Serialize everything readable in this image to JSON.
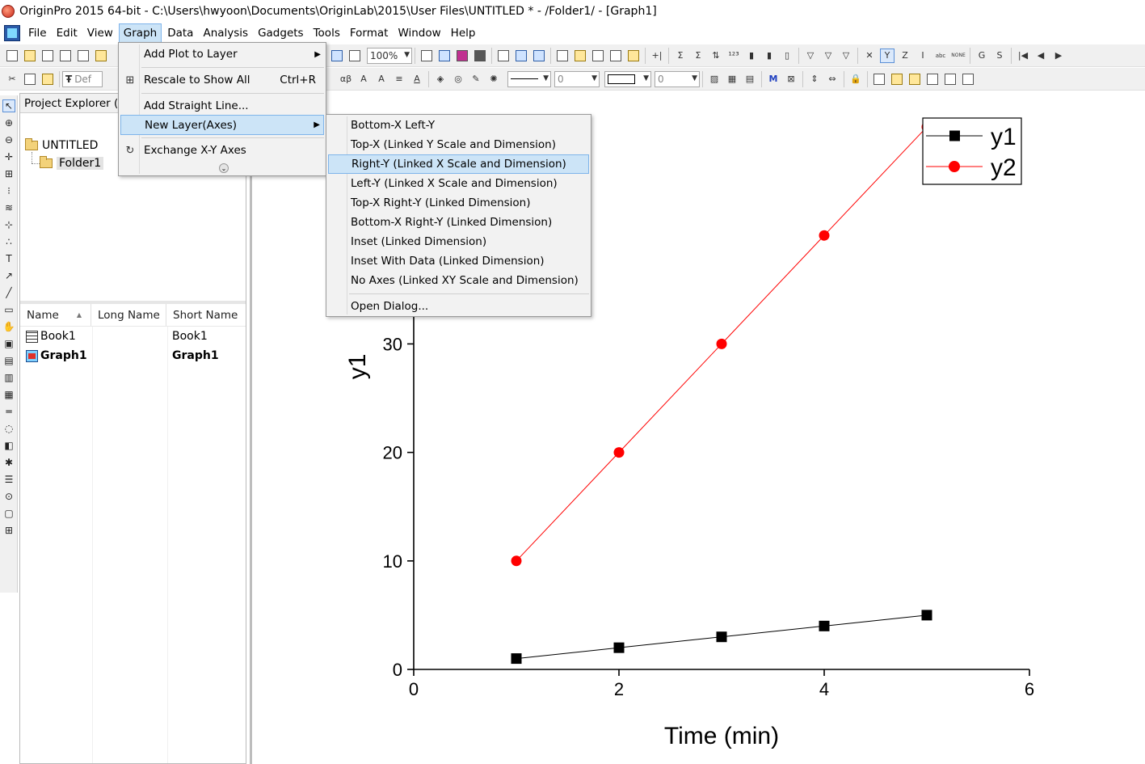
{
  "window": {
    "title": "OriginPro 2015 64-bit - C:\\Users\\hwyoon\\Documents\\OriginLab\\2015\\User Files\\UNTITLED * - /Folder1/ - [Graph1]"
  },
  "menubar": {
    "items": [
      "File",
      "Edit",
      "View",
      "Graph",
      "Data",
      "Analysis",
      "Gadgets",
      "Tools",
      "Format",
      "Window",
      "Help"
    ],
    "active": "Graph"
  },
  "toolbar": {
    "zoom": "100%",
    "font_combo": "Def",
    "line_width_value": "0",
    "border_value": "0"
  },
  "graph_menu": {
    "items": [
      {
        "label": "Add Plot to Layer",
        "has_submenu": true
      },
      {
        "label": "Rescale to Show All",
        "shortcut": "Ctrl+R"
      },
      {
        "label": "Add Straight Line..."
      },
      {
        "label": "New Layer(Axes)",
        "has_submenu": true,
        "highlighted": true
      },
      {
        "label": "Exchange X-Y Axes"
      }
    ]
  },
  "new_layer_submenu": {
    "items": [
      "Bottom-X Left-Y",
      "Top-X (Linked Y Scale and Dimension)",
      "Right-Y (Linked X Scale and Dimension)",
      "Left-Y (Linked X Scale and Dimension)",
      "Top-X Right-Y (Linked Dimension)",
      "Bottom-X Right-Y (Linked Dimension)",
      "Inset (Linked Dimension)",
      "Inset With Data (Linked Dimension)",
      "No Axes (Linked XY Scale and Dimension)",
      "Open Dialog..."
    ],
    "highlighted": "Right-Y (Linked X Scale and Dimension)"
  },
  "project_explorer": {
    "header": "Project Explorer (1)",
    "tree": {
      "root": "UNTITLED",
      "child": "Folder1"
    },
    "columns": [
      "Name",
      "Long Name",
      "Short Name"
    ],
    "rows": [
      {
        "name": "Book1",
        "long_name": "",
        "short_name": "Book1",
        "type": "book"
      },
      {
        "name": "Graph1",
        "long_name": "",
        "short_name": "Graph1",
        "type": "graph"
      }
    ]
  },
  "chart_data": {
    "type": "line",
    "xlabel": "Time (min)",
    "ylabel": "y1",
    "xlim": [
      0,
      6
    ],
    "ylim": [
      0,
      50
    ],
    "x_ticks": [
      0,
      2,
      4,
      6
    ],
    "y_ticks": [
      0,
      10,
      20,
      30
    ],
    "x": [
      1,
      2,
      3,
      4,
      5
    ],
    "series": [
      {
        "name": "y1",
        "values": [
          1,
          2,
          3,
          4,
          5
        ],
        "color": "#000000",
        "marker": "square"
      },
      {
        "name": "y2",
        "values": [
          10,
          20,
          30,
          40,
          50
        ],
        "color": "#ff0000",
        "marker": "circle"
      }
    ],
    "legend": "top-right",
    "grid": false
  }
}
